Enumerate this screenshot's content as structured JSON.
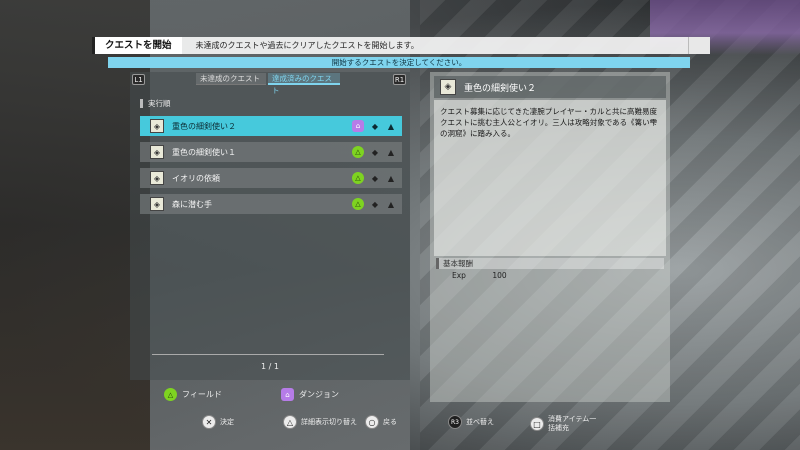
{
  "header": {
    "title": "クエストを開始",
    "description": "未達成のクエストや過去にクリアしたクエストを開始します。"
  },
  "instruction": "開始するクエストを決定してください。",
  "tabs": {
    "l_button": "L1",
    "r_button": "R1",
    "incomplete": "未達成のクエスト",
    "completed": "達成済みのクエスト"
  },
  "list": {
    "section_label": "実行順",
    "items": [
      {
        "name": "重色の細剣使い２",
        "type": "dungeon",
        "selected": true
      },
      {
        "name": "重色の細剣使い１",
        "type": "field",
        "selected": false
      },
      {
        "name": "イオリの依頼",
        "type": "field",
        "selected": false
      },
      {
        "name": "森に潜む手",
        "type": "field",
        "selected": false
      }
    ],
    "page": "1 / 1"
  },
  "detail": {
    "title": "重色の細剣使い２",
    "description": "クエスト募集に応じてきた凄腕プレイヤー・カルと共に高難易度クエストに挑む主人公とイオリ。三人は攻略対象である《篝い雫の洞窟》に踏み入る。",
    "reward_label": "基本報酬",
    "exp_label": "Exp",
    "exp_value": "100"
  },
  "legend": {
    "field": "フィールド",
    "dungeon": "ダンジョン"
  },
  "controls": {
    "confirm": "決定",
    "toggle_detail": "詳細表示切り替え",
    "back": "戻る",
    "sort": "並べ替え",
    "consume_items": "消費アイテム一括補充"
  },
  "colors": {
    "accent": "#46c9dc",
    "field": "#7ed321",
    "dungeon": "#b67ce8"
  }
}
